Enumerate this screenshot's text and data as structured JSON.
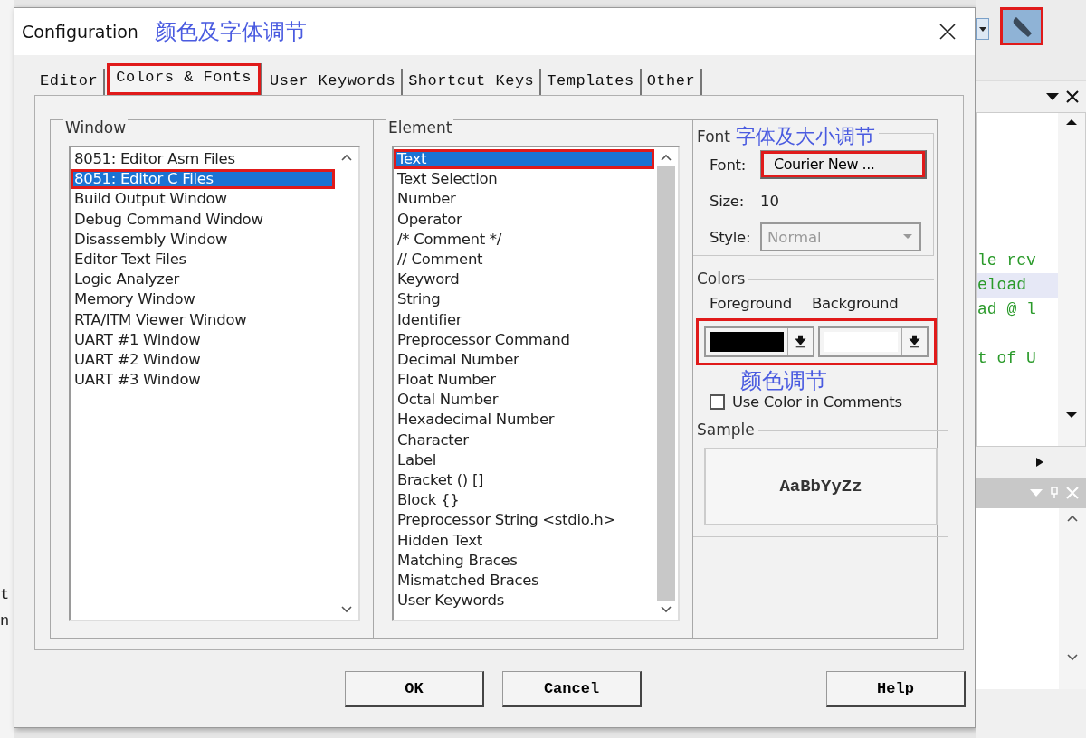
{
  "background_left": {
    "fragments": [
      "t",
      "n"
    ]
  },
  "dialog": {
    "title": "Configuration",
    "annotation": "颜色及字体调节"
  },
  "tabs": [
    {
      "label": "Editor",
      "selected": false,
      "annotated": false
    },
    {
      "label": "Colors & Fonts",
      "selected": true,
      "annotated": true
    },
    {
      "label": "User Keywords",
      "selected": false,
      "annotated": false
    },
    {
      "label": "Shortcut Keys",
      "selected": false,
      "annotated": false
    },
    {
      "label": "Templates",
      "selected": false,
      "annotated": false
    },
    {
      "label": "Other",
      "selected": false,
      "annotated": false
    }
  ],
  "window_group": {
    "legend": "Window",
    "items": [
      {
        "label": "8051: Editor Asm Files",
        "selected": false,
        "annotated": false
      },
      {
        "label": "8051: Editor C Files",
        "selected": true,
        "annotated": true
      },
      {
        "label": "Build Output Window",
        "selected": false,
        "annotated": false
      },
      {
        "label": "Debug Command Window",
        "selected": false,
        "annotated": false
      },
      {
        "label": "Disassembly Window",
        "selected": false,
        "annotated": false
      },
      {
        "label": "Editor Text Files",
        "selected": false,
        "annotated": false
      },
      {
        "label": "Logic Analyzer",
        "selected": false,
        "annotated": false
      },
      {
        "label": "Memory Window",
        "selected": false,
        "annotated": false
      },
      {
        "label": "RTA/ITM Viewer Window",
        "selected": false,
        "annotated": false
      },
      {
        "label": "UART #1 Window",
        "selected": false,
        "annotated": false
      },
      {
        "label": "UART #2 Window",
        "selected": false,
        "annotated": false
      },
      {
        "label": "UART #3 Window",
        "selected": false,
        "annotated": false
      }
    ]
  },
  "element_group": {
    "legend": "Element",
    "items": [
      {
        "label": "Text",
        "selected": true,
        "annotated": true
      },
      {
        "label": "Text Selection",
        "selected": false,
        "annotated": false
      },
      {
        "label": "Number",
        "selected": false,
        "annotated": false
      },
      {
        "label": "Operator",
        "selected": false,
        "annotated": false
      },
      {
        "label": "/* Comment */",
        "selected": false,
        "annotated": false
      },
      {
        "label": "// Comment",
        "selected": false,
        "annotated": false
      },
      {
        "label": "Keyword",
        "selected": false,
        "annotated": false
      },
      {
        "label": "String",
        "selected": false,
        "annotated": false
      },
      {
        "label": "Identifier",
        "selected": false,
        "annotated": false
      },
      {
        "label": "Preprocessor Command",
        "selected": false,
        "annotated": false
      },
      {
        "label": "Decimal Number",
        "selected": false,
        "annotated": false
      },
      {
        "label": "Float Number",
        "selected": false,
        "annotated": false
      },
      {
        "label": "Octal Number",
        "selected": false,
        "annotated": false
      },
      {
        "label": "Hexadecimal Number",
        "selected": false,
        "annotated": false
      },
      {
        "label": "Character",
        "selected": false,
        "annotated": false
      },
      {
        "label": "Label",
        "selected": false,
        "annotated": false
      },
      {
        "label": "Bracket () []",
        "selected": false,
        "annotated": false
      },
      {
        "label": "Block {}",
        "selected": false,
        "annotated": false
      },
      {
        "label": "Preprocessor String <stdio.h>",
        "selected": false,
        "annotated": false
      },
      {
        "label": "Hidden Text",
        "selected": false,
        "annotated": false
      },
      {
        "label": "Matching Braces",
        "selected": false,
        "annotated": false
      },
      {
        "label": "Mismatched Braces",
        "selected": false,
        "annotated": false
      },
      {
        "label": "User Keywords",
        "selected": false,
        "annotated": false
      }
    ]
  },
  "font_group": {
    "legend": "Font",
    "annotation": "字体及大小调节",
    "font_label": "Font:",
    "font_button": {
      "label": "Courier New ...",
      "annotated": true
    },
    "size_label": "Size:",
    "size_value": "10",
    "style_label": "Style:",
    "style_value": "Normal",
    "style_disabled": true
  },
  "colors_group": {
    "legend": "Colors",
    "foreground_label": "Foreground",
    "background_label": "Background",
    "annotated": true,
    "annotation": "颜色调节",
    "pickers": [
      {
        "color": "#000000"
      },
      {
        "color": "#ffffff"
      }
    ],
    "use_color_in_comments": {
      "label": "Use Color in Comments",
      "checked": false
    }
  },
  "sample_group": {
    "legend": "Sample",
    "text": "AaBbYyZz"
  },
  "buttons": [
    {
      "label": "OK"
    },
    {
      "label": "Cancel"
    },
    {
      "label": "Help"
    }
  ],
  "ide_right": {
    "settings_annotated": true,
    "code_lines": [
      {
        "text": "le rcv",
        "highlighted": false
      },
      {
        "text": "eload",
        "highlighted": true
      },
      {
        "text": "ad @ l",
        "highlighted": false
      },
      {
        "text": "t of U",
        "highlighted": false
      }
    ]
  }
}
